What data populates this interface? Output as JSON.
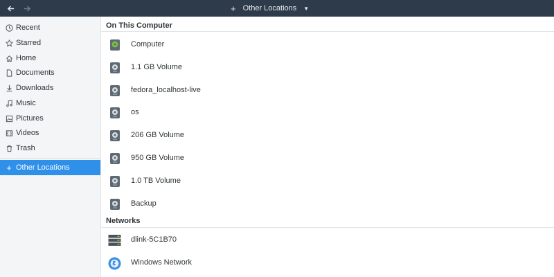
{
  "header": {
    "back_icon": "arrow-left-icon",
    "forward_icon": "arrow-right-icon",
    "location_plus": "+",
    "location_label": "Other Locations",
    "dropdown_icon": "caret-down-icon"
  },
  "sidebar": {
    "items": [
      {
        "label": "Recent",
        "icon": "clock-icon"
      },
      {
        "label": "Starred",
        "icon": "star-icon"
      },
      {
        "label": "Home",
        "icon": "home-icon"
      },
      {
        "label": "Documents",
        "icon": "document-icon"
      },
      {
        "label": "Downloads",
        "icon": "download-icon"
      },
      {
        "label": "Music",
        "icon": "music-icon"
      },
      {
        "label": "Pictures",
        "icon": "picture-icon"
      },
      {
        "label": "Videos",
        "icon": "video-icon"
      },
      {
        "label": "Trash",
        "icon": "trash-icon"
      }
    ],
    "other_locations": {
      "label": "Other Locations",
      "icon": "plus-icon",
      "active": true
    }
  },
  "main": {
    "on_this_computer": {
      "title": "On This Computer",
      "items": [
        {
          "label": "Computer",
          "icon": "computer-drive-icon"
        },
        {
          "label": "1.1 GB Volume",
          "icon": "drive-icon"
        },
        {
          "label": "fedora_localhost-live",
          "icon": "drive-icon"
        },
        {
          "label": "os",
          "icon": "drive-icon"
        },
        {
          "label": "206 GB Volume",
          "icon": "drive-icon"
        },
        {
          "label": "950 GB Volume",
          "icon": "drive-icon"
        },
        {
          "label": "1.0 TB Volume",
          "icon": "drive-icon"
        },
        {
          "label": "Backup",
          "icon": "drive-icon"
        }
      ]
    },
    "networks": {
      "title": "Networks",
      "items": [
        {
          "label": "dlink-5C1B70",
          "icon": "network-server-icon"
        },
        {
          "label": "Windows Network",
          "icon": "windows-network-icon"
        }
      ]
    }
  },
  "colors": {
    "headerbar": "#2e3b4a",
    "sidebar_bg": "#f3f5f7",
    "accent": "#2f90e9",
    "computer_disc": "#7bc043",
    "drive_body": "#5d6974"
  }
}
